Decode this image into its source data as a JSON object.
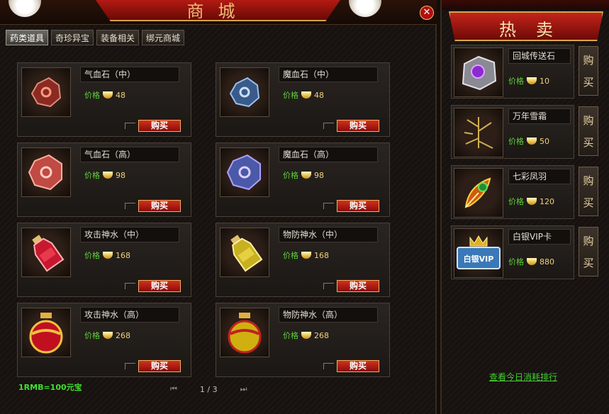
{
  "shop": {
    "banner_title": "商城",
    "close": "✕",
    "tabs": [
      "药类道具",
      "奇珍异宝",
      "装备相关",
      "绑元商城"
    ],
    "price_label": "价格",
    "buy_label": "购买",
    "items": [
      {
        "name": "气血石（中）",
        "price": "48"
      },
      {
        "name": "魔血石（中）",
        "price": "48"
      },
      {
        "name": "气血石（高）",
        "price": "98"
      },
      {
        "name": "魔血石（高）",
        "price": "98"
      },
      {
        "name": "攻击神水（中）",
        "price": "168"
      },
      {
        "name": "物防神水（中）",
        "price": "168"
      },
      {
        "name": "攻击神水（高）",
        "price": "268"
      },
      {
        "name": "物防神水（高）",
        "price": "268"
      }
    ],
    "rate_text": "1RMB=100元宝",
    "pager": {
      "first": "⏮",
      "page": "1 / 3",
      "last": "⏭"
    }
  },
  "hot": {
    "title": "热卖",
    "price_label": "价格",
    "buy_label_1": "购",
    "buy_label_2": "买",
    "items": [
      {
        "name": "回城传送石",
        "price": "10"
      },
      {
        "name": "万年雪霜",
        "price": "50"
      },
      {
        "name": "七彩凤羽",
        "price": "120"
      },
      {
        "name": "白银VIP卡",
        "price": "880"
      }
    ],
    "rank_link": "查看今日消耗排行",
    "vip_card_text": "白银VIP"
  },
  "colors": {
    "accent_red": "#b21a12",
    "price_green": "#5fd03a",
    "gold": "#f0d080"
  }
}
